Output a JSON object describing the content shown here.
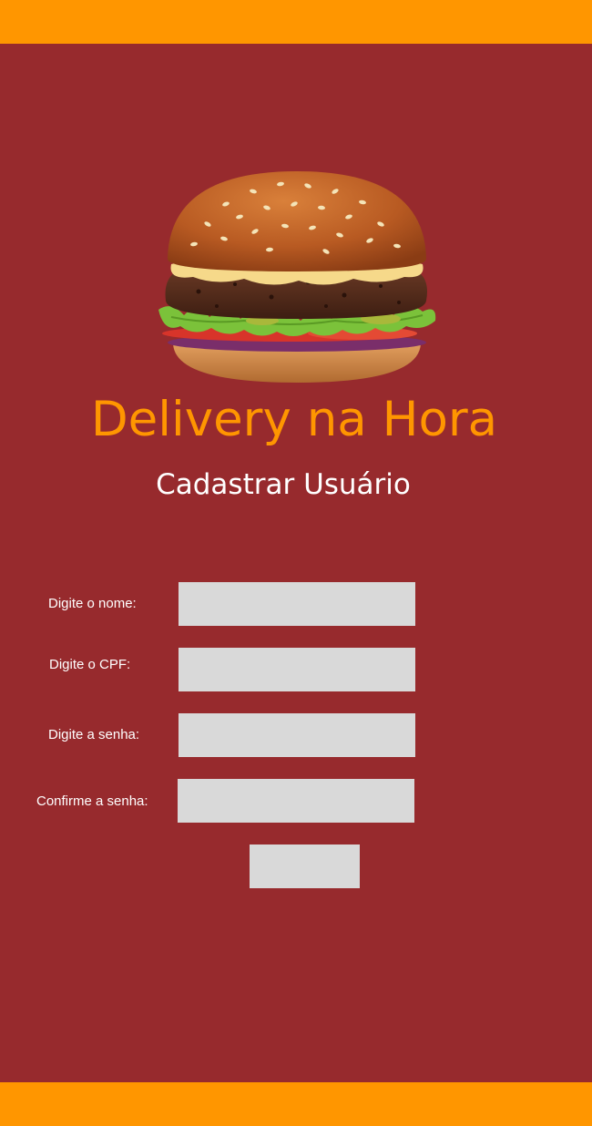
{
  "app": {
    "brand_title": "Delivery na Hora",
    "page_title": "Cadastrar Usuário"
  },
  "hero": {
    "icon": "burger-image"
  },
  "form": {
    "fields": [
      {
        "label": "Digite o nome:",
        "value": "",
        "placeholder": ""
      },
      {
        "label": "Digite o CPF:",
        "value": "",
        "placeholder": ""
      },
      {
        "label": "Digite a senha:",
        "value": "",
        "placeholder": ""
      },
      {
        "label": "Confirme a senha:",
        "value": "",
        "placeholder": ""
      }
    ],
    "submit_label": ""
  },
  "colors": {
    "background": "#972a2d",
    "accent": "#ff9600",
    "input_fill": "#d9d9d9",
    "text_light": "#ffffff"
  }
}
